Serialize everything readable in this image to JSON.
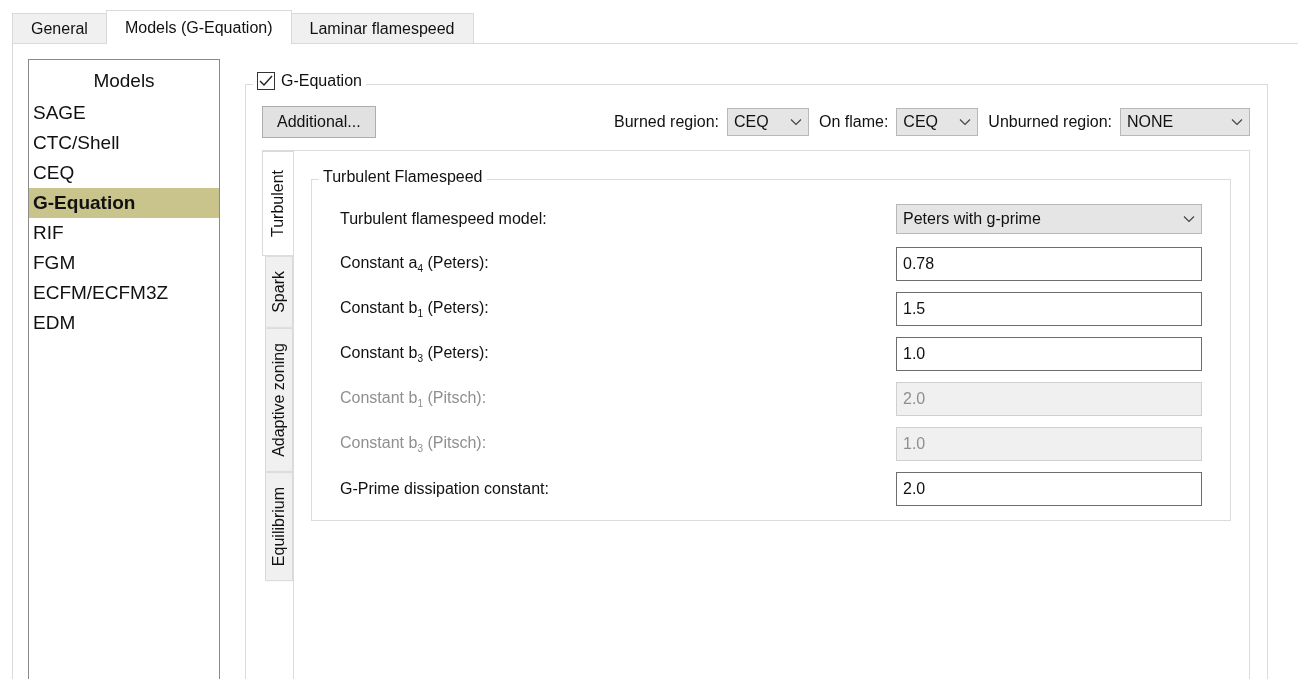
{
  "tabs": [
    {
      "label": "General",
      "selected": false
    },
    {
      "label": "Models (G-Equation)",
      "selected": true
    },
    {
      "label": "Laminar flamespeed",
      "selected": false
    }
  ],
  "models": {
    "title": "Models",
    "items": [
      {
        "label": "SAGE",
        "selected": false
      },
      {
        "label": "CTC/Shell",
        "selected": false
      },
      {
        "label": "CEQ",
        "selected": false
      },
      {
        "label": "G-Equation",
        "selected": true
      },
      {
        "label": "RIF",
        "selected": false
      },
      {
        "label": "FGM",
        "selected": false
      },
      {
        "label": "ECFM/ECFM3Z",
        "selected": false
      },
      {
        "label": "EDM",
        "selected": false
      }
    ]
  },
  "g_equation": {
    "label": "G-Equation",
    "checked": true,
    "additional_button": "Additional...",
    "region_selects": [
      {
        "label": "Burned region:",
        "value": "CEQ"
      },
      {
        "label": "On flame:",
        "value": "CEQ"
      },
      {
        "label": "Unburned region:",
        "value": "NONE"
      }
    ],
    "side_tabs": [
      {
        "label": "Turbulent",
        "selected": true
      },
      {
        "label": "Spark",
        "selected": false
      },
      {
        "label": "Adaptive zoning",
        "selected": false
      },
      {
        "label": "Equilibrium",
        "selected": false
      }
    ],
    "group_title": "Turbulent Flamespeed",
    "fields": [
      {
        "kind": "select",
        "label": "Turbulent flamespeed model:",
        "value": "Peters with g-prime",
        "disabled": false
      },
      {
        "kind": "text",
        "label": "Constant a$_{4}$ (Peters):",
        "value": "0.78",
        "disabled": false
      },
      {
        "kind": "text",
        "label": "Constant b$_{1}$ (Peters):",
        "value": "1.5",
        "disabled": false
      },
      {
        "kind": "text",
        "label": "Constant b$_{3}$ (Peters):",
        "value": "1.0",
        "disabled": false
      },
      {
        "kind": "text",
        "label": "Constant b$_{1}$ (Pitsch):",
        "value": "2.0",
        "disabled": true
      },
      {
        "kind": "text",
        "label": "Constant b$_{3}$ (Pitsch):",
        "value": "1.0",
        "disabled": true
      },
      {
        "kind": "text",
        "label": "G-Prime dissipation constant:",
        "value": "2.0",
        "disabled": false
      }
    ]
  }
}
